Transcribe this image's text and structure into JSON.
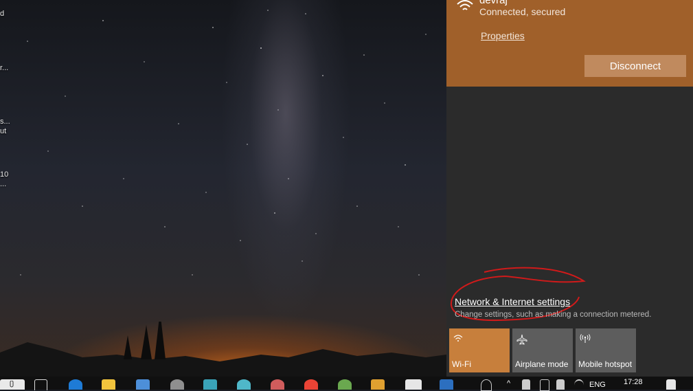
{
  "desktop": {
    "labels": [
      "d",
      "r...",
      "s...",
      "ut",
      "10",
      "..."
    ]
  },
  "wifi": {
    "ssid": "devraj",
    "status": "Connected, secured",
    "properties_label": "Properties",
    "disconnect_label": "Disconnect",
    "accent_color": "#a0602a"
  },
  "network_settings": {
    "title": "Network & Internet settings",
    "description": "Change settings, such as making a connection metered."
  },
  "quick_actions": [
    {
      "label": "Wi-Fi",
      "icon": "wifi-icon",
      "active": true
    },
    {
      "label": "Airplane mode",
      "icon": "airplane-icon",
      "active": false
    },
    {
      "label": "Mobile hotspot",
      "icon": "hotspot-icon",
      "active": false
    }
  ],
  "taskbar": {
    "language": "ENG",
    "time": "17:28",
    "apps": [
      "task-view-icon",
      "edge-icon",
      "file-explorer-icon",
      "store-icon",
      "settings-gear-icon",
      "photos-icon",
      "media-icon",
      "calendar-icon",
      "chrome-icon",
      "app-icon",
      "media-player-icon",
      "mail-icon",
      "powershell-icon"
    ]
  }
}
